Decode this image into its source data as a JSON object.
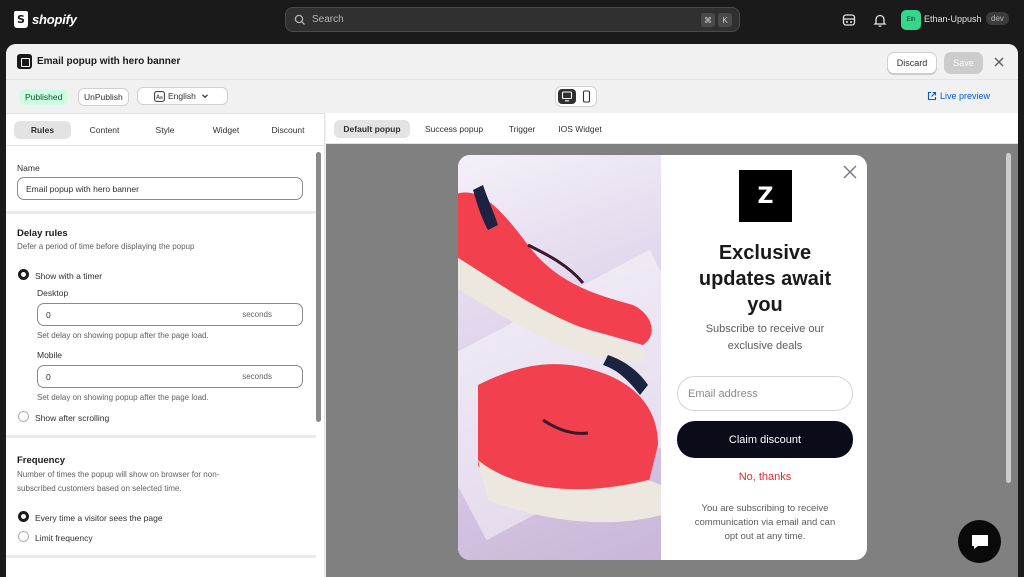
{
  "topbar": {
    "brand": "shopify",
    "search_placeholder": "Search",
    "shortcut_keys": [
      "⌘",
      "K"
    ],
    "avatar_initials": "Eth",
    "store_name": "Ethan-Uppush",
    "env_badge": "dev"
  },
  "modal": {
    "title": "Email popup with hero banner",
    "discard_label": "Discard",
    "save_label": "Save",
    "status_badge": "Published",
    "unpublish_label": "UnPublish",
    "language": "English",
    "live_preview_label": "Live preview"
  },
  "left_tabs": [
    "Rules",
    "Content",
    "Style",
    "Widget",
    "Discount"
  ],
  "rules": {
    "name_label": "Name",
    "name_value": "Email popup with hero banner",
    "delay_heading": "Delay rules",
    "delay_help": "Defer a period of time before displaying the popup",
    "timer_option": "Show with a timer",
    "desktop_label": "Desktop",
    "desktop_value": "0",
    "mobile_label": "Mobile",
    "mobile_value": "0",
    "seconds_suffix": "seconds",
    "delay_note": "Set delay on showing popup after the page load.",
    "scroll_option": "Show after scrolling",
    "frequency_heading": "Frequency",
    "frequency_help_line1": "Number of times the popup will show on browser for non-",
    "frequency_help_line2": "subscribed customers based on selected time.",
    "freq_option_every": "Every time a visitor sees the page",
    "freq_option_limit": "Limit frequency"
  },
  "right_tabs": [
    "Default popup",
    "Success popup",
    "Trigger",
    "IOS Widget"
  ],
  "popup": {
    "logo_text": "Z",
    "title_lines": [
      "Exclusive",
      "updates await",
      "you"
    ],
    "subtitle_lines": [
      "Subscribe to receive our",
      "exclusive deals"
    ],
    "email_placeholder": "Email address",
    "claim_label": "Claim discount",
    "decline_label": "No, thanks",
    "footer_lines": [
      "You are subscribing to receive",
      "communication via email and can",
      "opt out at any time."
    ]
  },
  "colors": {
    "accent_link": "#005bd3",
    "published_bg": "#cdfee1",
    "claim_button": "#0a0c1a",
    "decline_text": "#e02b2b",
    "shoe_red": "#f2404f"
  }
}
